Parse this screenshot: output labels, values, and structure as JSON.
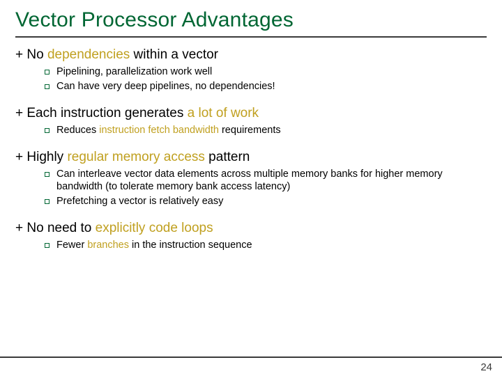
{
  "title": "Vector Processor Advantages",
  "points": [
    {
      "prefix": "+ No ",
      "accent": "dependencies",
      "suffix": " within a vector",
      "subs": [
        {
          "text": "Pipelining, parallelization work well"
        },
        {
          "text": "Can have very deep pipelines, no dependencies!"
        }
      ]
    },
    {
      "prefix": "+ Each instruction generates ",
      "accent": "a lot of work",
      "suffix": "",
      "subs": [
        {
          "prefix": "Reduces ",
          "accent": "instruction fetch bandwidth",
          "suffix": " requirements"
        }
      ]
    },
    {
      "prefix": "+ Highly ",
      "accent": "regular memory access",
      "suffix": " pattern",
      "subs": [
        {
          "text": "Can interleave vector data elements across multiple memory banks for higher memory bandwidth (to tolerate memory bank access latency)"
        },
        {
          "text": "Prefetching a vector is relatively easy"
        }
      ]
    },
    {
      "prefix": "+ No need to ",
      "accent": "explicitly code loops",
      "suffix": "",
      "subs": [
        {
          "prefix": "Fewer ",
          "accent": "branches",
          "suffix": " in the instruction sequence"
        }
      ]
    }
  ],
  "page_number": "24"
}
